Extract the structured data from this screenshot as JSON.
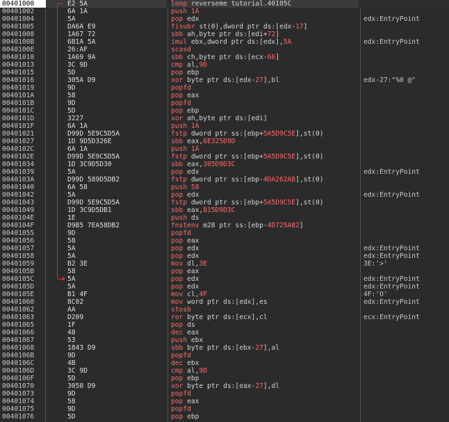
{
  "rows": [
    {
      "addr": "00401000",
      "bytes": "E2 5A",
      "mnem": "loop",
      "ops": "reverseme tutorial.40105C",
      "comment": ""
    },
    {
      "addr": "00401002",
      "bytes": "6A 1A",
      "mnem": "push",
      "ops": "1A",
      "comment": ""
    },
    {
      "addr": "00401004",
      "bytes": "5A",
      "mnem": "pop",
      "ops": "edx",
      "comment": "edx:EntryPoint"
    },
    {
      "addr": "00401005",
      "bytes": "DA6A E9",
      "mnem": "fisubr",
      "ops": "st(0),dword ptr ds:[edx-17]",
      "comment": ""
    },
    {
      "addr": "00401008",
      "bytes": "1A67 72",
      "mnem": "sbb",
      "ops": "ah,byte ptr ds:[edi+72]",
      "comment": ""
    },
    {
      "addr": "0040100B",
      "bytes": "6B1A 5A",
      "mnem": "imul",
      "ops": "ebx,dword ptr ds:[edx],5A",
      "comment": "edx:EntryPoint"
    },
    {
      "addr": "0040100E",
      "bytes": "26:AF",
      "mnem": "scasd",
      "ops": "",
      "comment": ""
    },
    {
      "addr": "00401010",
      "bytes": "1A69 9A",
      "mnem": "sbb",
      "ops": "ch,byte ptr ds:[ecx-66]",
      "comment": ""
    },
    {
      "addr": "00401013",
      "bytes": "3C 9D",
      "mnem": "cmp",
      "ops": "al,9D",
      "comment": ""
    },
    {
      "addr": "00401015",
      "bytes": "5D",
      "mnem": "pop",
      "ops": "ebp",
      "comment": ""
    },
    {
      "addr": "00401016",
      "bytes": "305A D9",
      "mnem": "xor",
      "ops": "byte ptr ds:[edx-27],bl",
      "comment": "edx-27:\"%0 @\""
    },
    {
      "addr": "00401019",
      "bytes": "9D",
      "mnem": "popfd",
      "ops": "",
      "comment": ""
    },
    {
      "addr": "0040101A",
      "bytes": "58",
      "mnem": "pop",
      "ops": "eax",
      "comment": ""
    },
    {
      "addr": "0040101B",
      "bytes": "9D",
      "mnem": "popfd",
      "ops": "",
      "comment": ""
    },
    {
      "addr": "0040101C",
      "bytes": "5D",
      "mnem": "pop",
      "ops": "ebp",
      "comment": ""
    },
    {
      "addr": "0040101D",
      "bytes": "3227",
      "mnem": "xor",
      "ops": "ah,byte ptr ds:[edi]",
      "comment": ""
    },
    {
      "addr": "0040101F",
      "bytes": "6A 1A",
      "mnem": "push",
      "ops": "1A",
      "comment": ""
    },
    {
      "addr": "00401021",
      "bytes": "D99D 5E9C5D5A",
      "mnem": "fstp",
      "ops": "dword ptr ss:[ebp+5A5D9C5E],st(0)",
      "comment": ""
    },
    {
      "addr": "00401027",
      "bytes": "1D 9D5D326E",
      "mnem": "sbb",
      "ops": "eax,6E325D9D",
      "comment": ""
    },
    {
      "addr": "0040102C",
      "bytes": "6A 1A",
      "mnem": "push",
      "ops": "1A",
      "comment": ""
    },
    {
      "addr": "0040102E",
      "bytes": "D99D 5E9C5D5A",
      "mnem": "fstp",
      "ops": "dword ptr ss:[ebp+5A5D9C5E],st(0)",
      "comment": ""
    },
    {
      "addr": "00401034",
      "bytes": "1D 3C9D5D30",
      "mnem": "sbb",
      "ops": "eax,305D9D3C",
      "comment": ""
    },
    {
      "addr": "00401039",
      "bytes": "5A",
      "mnem": "pop",
      "ops": "edx",
      "comment": "edx:EntryPoint"
    },
    {
      "addr": "0040103A",
      "bytes": "D99D 589D5DB2",
      "mnem": "fstp",
      "ops": "dword ptr ss:[ebp-4DA262A8],st(0)",
      "comment": ""
    },
    {
      "addr": "00401040",
      "bytes": "6A 58",
      "mnem": "push",
      "ops": "58",
      "comment": ""
    },
    {
      "addr": "00401042",
      "bytes": "5A",
      "mnem": "pop",
      "ops": "edx",
      "comment": "edx:EntryPoint"
    },
    {
      "addr": "00401043",
      "bytes": "D99D 5E9C5D5A",
      "mnem": "fstp",
      "ops": "dword ptr ss:[ebp+5A5D9C5E],st(0)",
      "comment": ""
    },
    {
      "addr": "00401049",
      "bytes": "1D 3C9D5DB1",
      "mnem": "sbb",
      "ops": "eax,B15D9D3C",
      "comment": ""
    },
    {
      "addr": "0040104E",
      "bytes": "1E",
      "mnem": "push",
      "ops": "ds",
      "comment": ""
    },
    {
      "addr": "0040104F",
      "bytes": "D9B5 7EA58DB2",
      "mnem": "fnstenv",
      "ops": "m28 ptr ss:[ebp-4D725A82]",
      "comment": ""
    },
    {
      "addr": "00401055",
      "bytes": "9D",
      "mnem": "popfd",
      "ops": "",
      "comment": ""
    },
    {
      "addr": "00401056",
      "bytes": "58",
      "mnem": "pop",
      "ops": "eax",
      "comment": ""
    },
    {
      "addr": "00401057",
      "bytes": "5A",
      "mnem": "pop",
      "ops": "edx",
      "comment": "edx:EntryPoint"
    },
    {
      "addr": "00401058",
      "bytes": "5A",
      "mnem": "pop",
      "ops": "edx",
      "comment": "edx:EntryPoint"
    },
    {
      "addr": "00401059",
      "bytes": "B2 3E",
      "mnem": "mov",
      "ops": "dl,3E",
      "comment": "3E:'>'"
    },
    {
      "addr": "0040105B",
      "bytes": "58",
      "mnem": "pop",
      "ops": "eax",
      "comment": ""
    },
    {
      "addr": "0040105C",
      "bytes": "5A",
      "mnem": "pop",
      "ops": "edx",
      "comment": "edx:EntryPoint"
    },
    {
      "addr": "0040105D",
      "bytes": "5A",
      "mnem": "pop",
      "ops": "edx",
      "comment": "edx:EntryPoint"
    },
    {
      "addr": "0040105E",
      "bytes": "B1 4F",
      "mnem": "mov",
      "ops": "cl,4F",
      "comment": "4F:'O'"
    },
    {
      "addr": "00401060",
      "bytes": "8C02",
      "mnem": "mov",
      "ops": "word ptr ds:[edx],es",
      "comment": "edx:EntryPoint"
    },
    {
      "addr": "00401062",
      "bytes": "AA",
      "mnem": "stosb",
      "ops": "",
      "comment": ""
    },
    {
      "addr": "00401063",
      "bytes": "D209",
      "mnem": "ror",
      "ops": "byte ptr ds:[ecx],cl",
      "comment": "ecx:EntryPoint"
    },
    {
      "addr": "00401065",
      "bytes": "1F",
      "mnem": "pop",
      "ops": "ds",
      "comment": ""
    },
    {
      "addr": "00401066",
      "bytes": "48",
      "mnem": "dec",
      "ops": "eax",
      "comment": ""
    },
    {
      "addr": "00401067",
      "bytes": "53",
      "mnem": "push",
      "ops": "ebx",
      "comment": ""
    },
    {
      "addr": "00401068",
      "bytes": "1843 D9",
      "mnem": "sbb",
      "ops": "byte ptr ds:[ebx-27],al",
      "comment": ""
    },
    {
      "addr": "0040106B",
      "bytes": "9D",
      "mnem": "popfd",
      "ops": "",
      "comment": ""
    },
    {
      "addr": "0040106C",
      "bytes": "4B",
      "mnem": "dec",
      "ops": "ebx",
      "comment": ""
    },
    {
      "addr": "0040106D",
      "bytes": "3C 9D",
      "mnem": "cmp",
      "ops": "al,9D",
      "comment": ""
    },
    {
      "addr": "0040106F",
      "bytes": "5D",
      "mnem": "pop",
      "ops": "ebp",
      "comment": ""
    },
    {
      "addr": "00401070",
      "bytes": "3050 D9",
      "mnem": "xor",
      "ops": "byte ptr ds:[eax-27],dl",
      "comment": ""
    },
    {
      "addr": "00401073",
      "bytes": "9D",
      "mnem": "popfd",
      "ops": "",
      "comment": ""
    },
    {
      "addr": "00401074",
      "bytes": "58",
      "mnem": "pop",
      "ops": "eax",
      "comment": ""
    },
    {
      "addr": "00401075",
      "bytes": "9D",
      "mnem": "popfd",
      "ops": "",
      "comment": ""
    },
    {
      "addr": "00401076",
      "bytes": "5D",
      "mnem": "pop",
      "ops": "ebp",
      "comment": ""
    }
  ],
  "selected_index": 0,
  "jump": {
    "from_index": 0,
    "to_index": 36
  },
  "colors": {
    "background": "#2b2b2b",
    "text": "#c8c8c8",
    "mnemonic": "#f07070",
    "selection_addr_bg": "#ffffff",
    "jump_line": "#cc3333"
  }
}
